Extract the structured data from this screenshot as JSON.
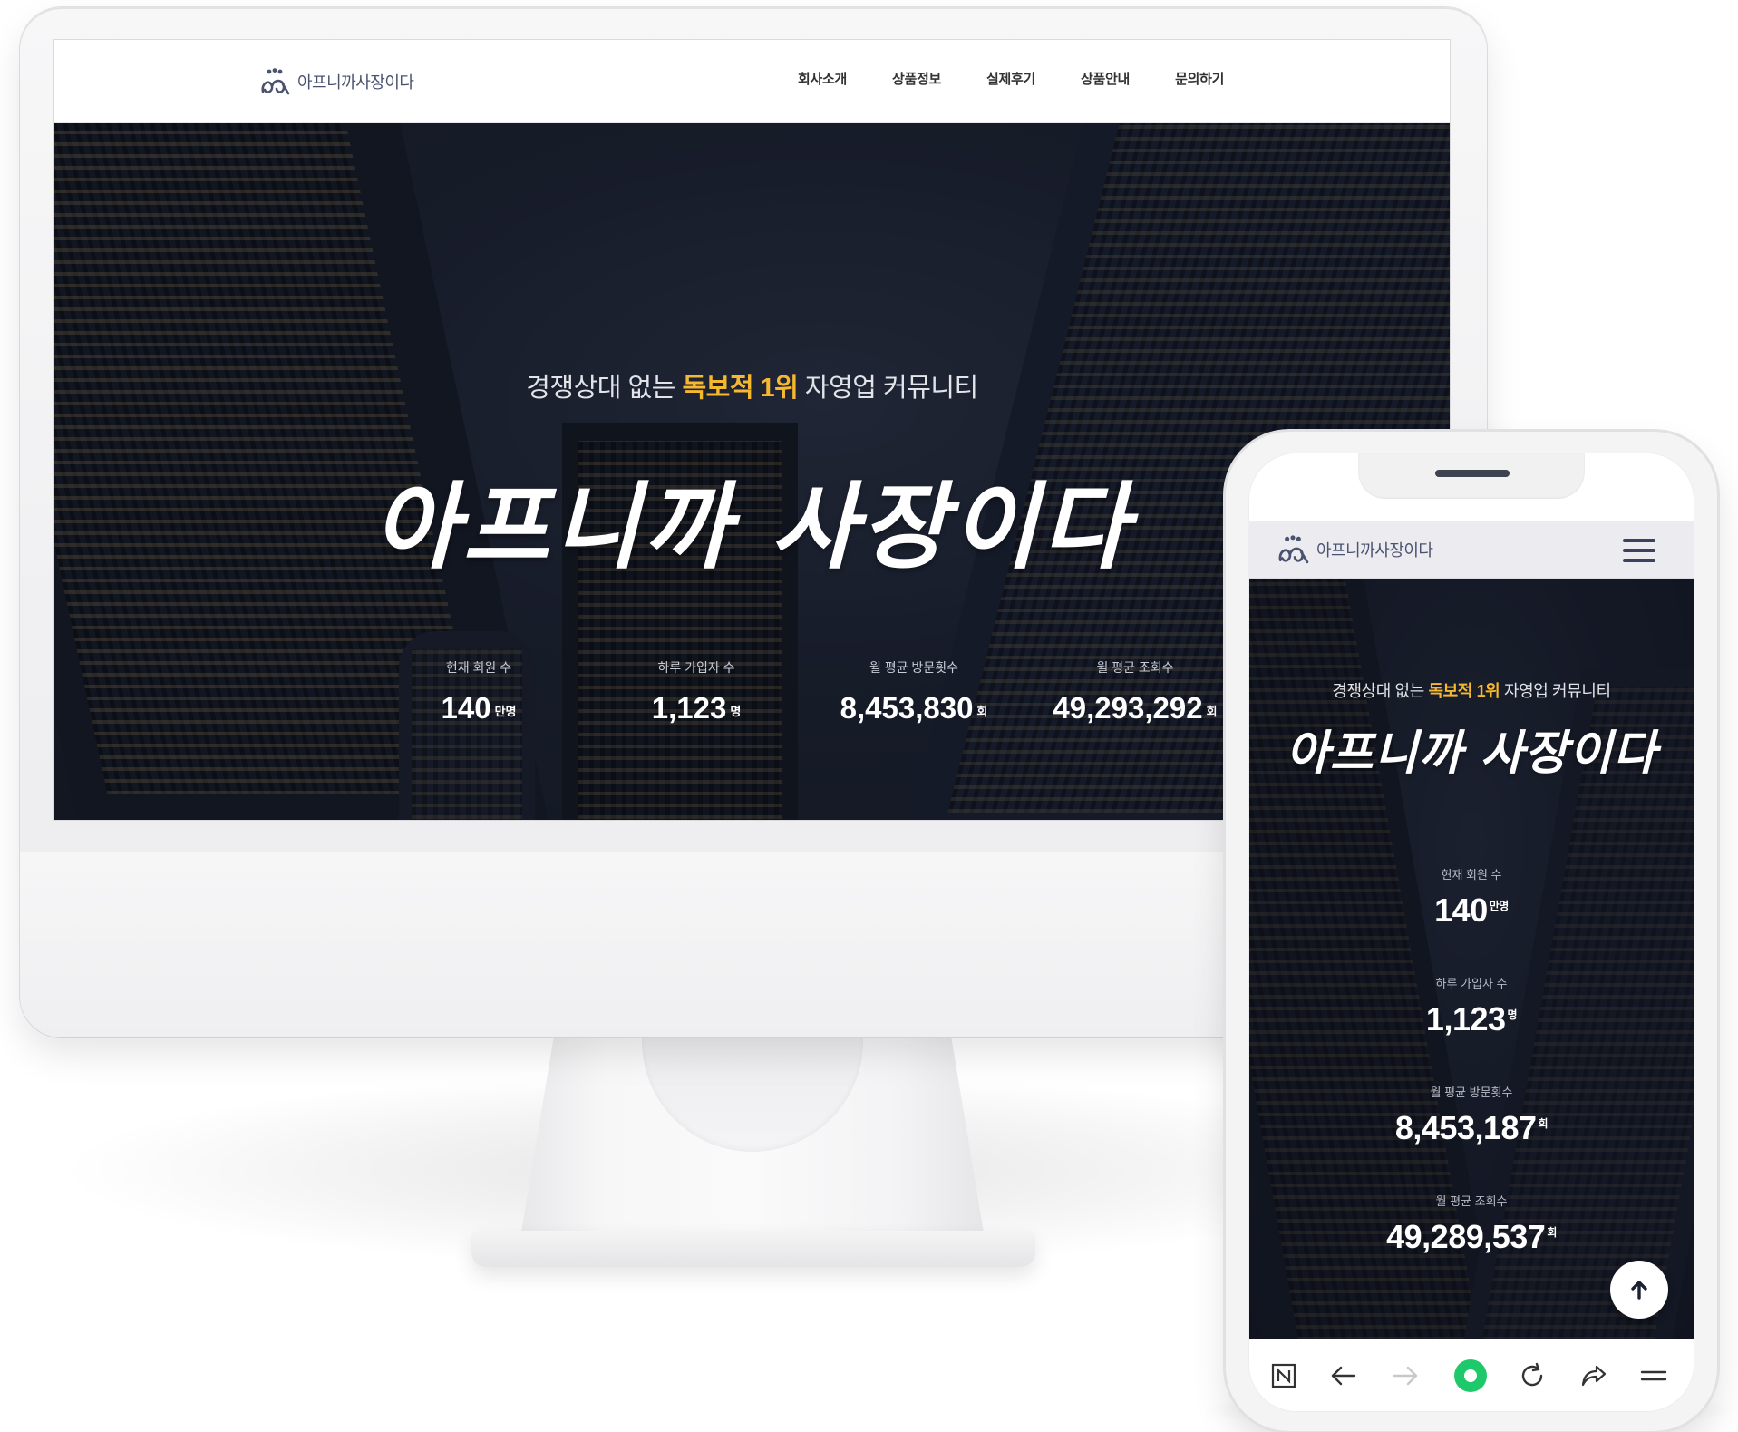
{
  "site": {
    "logo_text": "아프니까사장이다",
    "nav": [
      "회사소개",
      "상품정보",
      "실제후기",
      "상품안내",
      "문의하기"
    ],
    "hero": {
      "subtitle_pre": "경쟁상대 없는 ",
      "subtitle_highlight": "독보적 1위",
      "subtitle_post": " 자영업 커뮤니티",
      "title": "아프니까 사장이다"
    }
  },
  "desktop_stats": [
    {
      "label": "현재 회원 수",
      "value": "140",
      "unit": "만명"
    },
    {
      "label": "하루 가입자 수",
      "value": "1,123",
      "unit": "명"
    },
    {
      "label": "월 평균 방문횟수",
      "value": "8,453,830",
      "unit": "회"
    },
    {
      "label": "월 평균 조회수",
      "value": "49,293,292",
      "unit": "회"
    }
  ],
  "mobile_stats": [
    {
      "label": "현재 회원 수",
      "value": "140",
      "unit": "만명"
    },
    {
      "label": "하루 가입자 수",
      "value": "1,123",
      "unit": "명"
    },
    {
      "label": "월 평균 방문횟수",
      "value": "8,453,187",
      "unit": "회"
    },
    {
      "label": "월 평균 조회수",
      "value": "49,289,537",
      "unit": "회"
    }
  ],
  "mobile_toolbar": [
    "naver-home-icon",
    "back-arrow-icon",
    "forward-arrow-icon",
    "green-circle-icon",
    "refresh-icon",
    "share-icon",
    "hamburger-lines-icon"
  ],
  "colors": {
    "accent": "#f6b731",
    "logo": "#4a5270",
    "hero_bg": "#1d2230",
    "toolbar_green": "#1ec96b"
  }
}
